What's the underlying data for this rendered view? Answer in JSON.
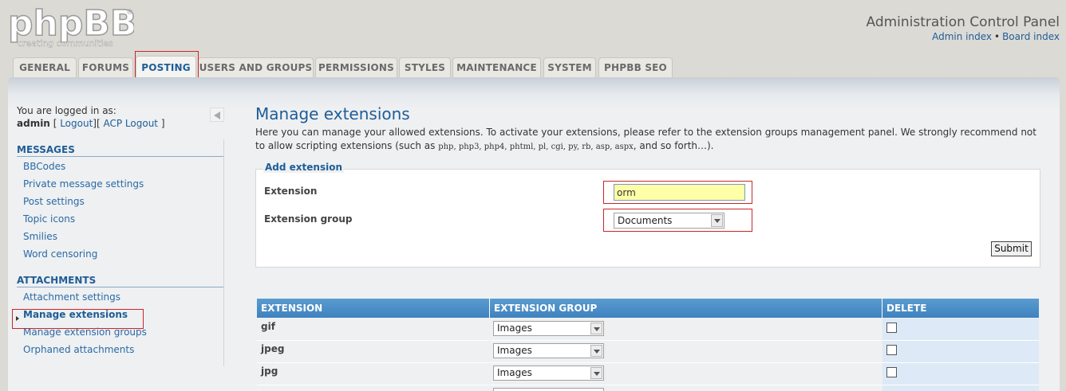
{
  "header": {
    "logo_text": "phpBB",
    "logo_tagline": "creating communities",
    "title": "Administration Control Panel",
    "links": [
      "Admin index",
      "Board index"
    ],
    "link_separator": "•"
  },
  "tabs": [
    "GENERAL",
    "FORUMS",
    "POSTING",
    "USERS AND GROUPS",
    "PERMISSIONS",
    "STYLES",
    "MAINTENANCE",
    "SYSTEM",
    "PHPBB SEO"
  ],
  "active_tab": "POSTING",
  "sidebar": {
    "logged_in_label": "You are logged in as:",
    "username": "admin",
    "logout_link": "Logout",
    "acp_logout_link": "ACP Logout",
    "bracket_open": "[",
    "bracket_mid": "][",
    "bracket_close": "]",
    "sections": [
      {
        "title": "MESSAGES",
        "items": [
          "BBCodes",
          "Private message settings",
          "Post settings",
          "Topic icons",
          "Smilies",
          "Word censoring"
        ]
      },
      {
        "title": "ATTACHMENTS",
        "items": [
          "Attachment settings",
          "Manage extensions",
          "Manage extension groups",
          "Orphaned attachments"
        ]
      }
    ],
    "active_item": "Manage extensions"
  },
  "main": {
    "title": "Manage extensions",
    "description_line1": "Here you can manage your allowed extensions. To activate your extensions, please refer to the extension groups management panel. We strongly recommend not",
    "description_prefix": "to allow scripting extensions (such as ",
    "description_codes": "php, php3, php4, phtml, pl, cgi, py, rb, asp, aspx",
    "description_suffix": ", and so forth…).",
    "add_form": {
      "legend": "Add extension",
      "extension_label": "Extension",
      "extension_value": "orm",
      "group_label": "Extension group",
      "group_value": "Documents",
      "submit_label": "Submit"
    },
    "table": {
      "headers": [
        "EXTENSION",
        "EXTENSION GROUP",
        "DELETE"
      ],
      "rows": [
        {
          "extension": "gif",
          "group": "Images",
          "delete": false
        },
        {
          "extension": "jpeg",
          "group": "Images",
          "delete": false
        },
        {
          "extension": "jpg",
          "group": "Images",
          "delete": false
        }
      ]
    }
  },
  "colors": {
    "accent": "#1f5d96",
    "highlight_border": "#c8262b",
    "input_bg": "#ffffa8",
    "table_header": "#4a8cc8"
  }
}
